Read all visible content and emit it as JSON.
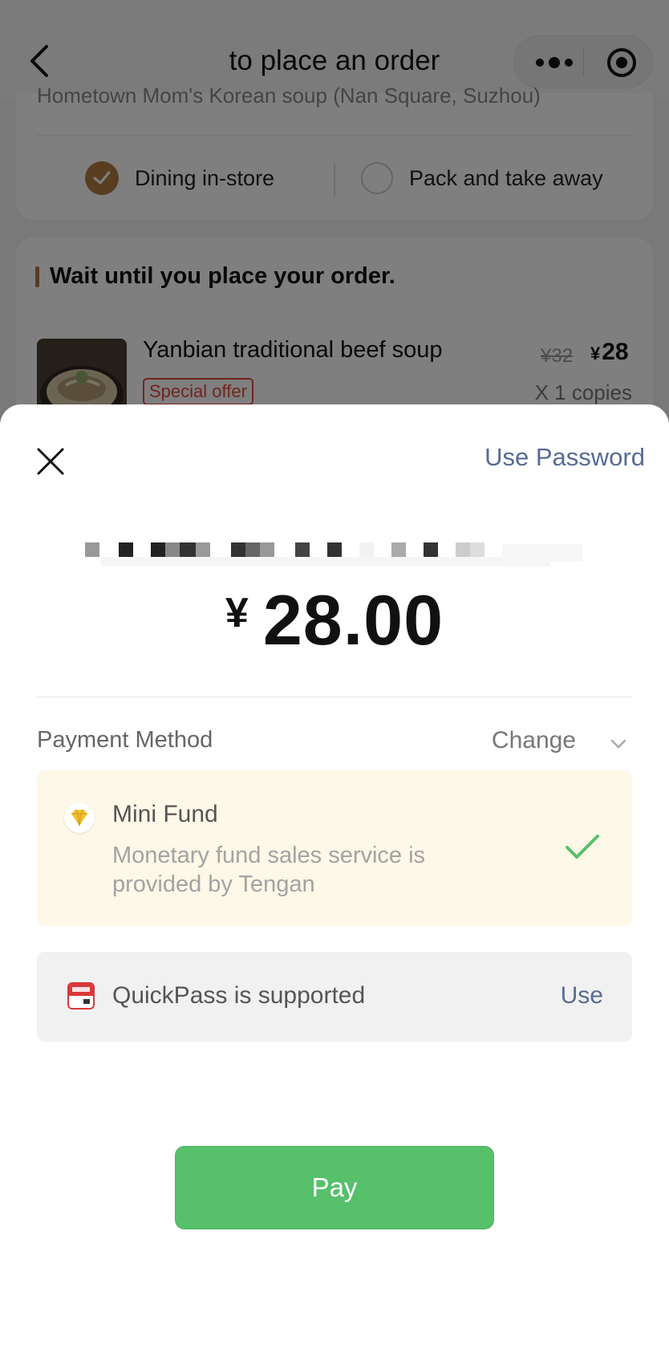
{
  "navbar": {
    "title": "to place an order",
    "back_icon": "chevron-left-icon",
    "more_icon": "more-dots-icon",
    "close_icon": "mini-program-close-icon"
  },
  "order": {
    "store_name": "Hometown Mom's Korean soup (Nan Square, Suzhou)",
    "dine_options": {
      "dine_in": "Dining in-store",
      "take_away": "Pack and take away",
      "selected": "dine_in"
    },
    "section_title": "Wait until you place your order.",
    "item": {
      "name": "Yanbian traditional beef soup",
      "tag": "Special offer",
      "original_price": "¥32",
      "currency": "¥",
      "price": "28",
      "quantity": "X 1 copies"
    }
  },
  "payment": {
    "close_icon": "close-icon",
    "use_password": "Use Password",
    "amount_currency": "¥",
    "amount": "28.00",
    "method_label": "Payment Method",
    "change_label": "Change",
    "selected_method": {
      "icon": "diamond-icon",
      "title": "Mini Fund",
      "description": "Monetary fund sales service is provided by Tengan",
      "check_icon": "checkmark-icon"
    },
    "quickpass": {
      "icon": "unionpay-quickpass-icon",
      "label": "QuickPass is supported",
      "action": "Use"
    },
    "pay_button": "Pay"
  },
  "colors": {
    "accent_brown": "#b07a43",
    "link_blue": "#576b95",
    "pay_green": "#57c06b",
    "check_green": "#57c06b",
    "fund_card_bg": "#fdf8e7",
    "offer_red": "#e04a3f"
  }
}
